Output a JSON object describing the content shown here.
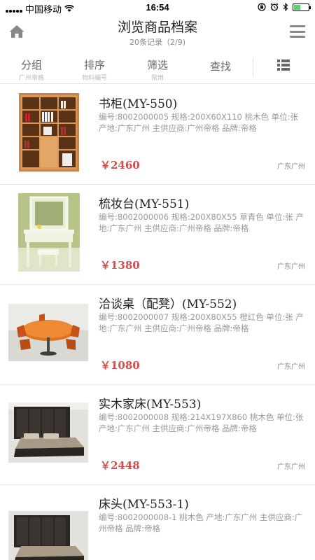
{
  "status_bar": {
    "carrier": "中国移动",
    "time": "16:54",
    "battery_level": 0.45
  },
  "header": {
    "title": "浏览商品档案",
    "subtitle": "20条记录（2/9)",
    "home_icon": "home-icon",
    "menu_icon": "hamburger-menu-icon"
  },
  "toolbar": {
    "group": {
      "label": "分组",
      "sub": "广州帝格"
    },
    "sort": {
      "label": "排序",
      "sub": "物料编号"
    },
    "filter": {
      "label": "筛选",
      "sub": "常用"
    },
    "search": {
      "label": "查找"
    },
    "view_icon": "list-view-icon"
  },
  "products": [
    {
      "name": "书柜(MY-550)",
      "desc": "编号:8002000005 规格:200X60X110 桃木色 单位:张 产地:广东广州 主供应商:广州帝格 品牌:帝格",
      "price": "￥2460",
      "location": "广东广州"
    },
    {
      "name": "梳妆台(MY-551)",
      "desc": "编号:8002000006 规格:200X80X55 草青色 单位:张 产地:广东广州 主供应商:广州帝格 品牌:帝格",
      "price": "￥1380",
      "location": "广东广州"
    },
    {
      "name": "洽谈桌（配凳）(MY-552)",
      "desc": "编号:8002000007 规格:200X80X55 橙红色 单位:张 产地:广东广州 主供应商:广州帝格 品牌:帝格",
      "price": "￥1080",
      "location": "广东广州"
    },
    {
      "name": "实木家床(MY-553)",
      "desc": "编号:8002000008 规格:214X197X860 桃木色 单位:张 产地:广东广州 主供应商:广州帝格 品牌:帝格",
      "price": "￥2448",
      "location": "广东广州"
    },
    {
      "name": "床头(MY-553-1)",
      "desc": "编号:8002000008-1 桃木色 产地:广东广州 主供应商:广州帝格 品牌:帝格",
      "price": "",
      "location": ""
    }
  ]
}
